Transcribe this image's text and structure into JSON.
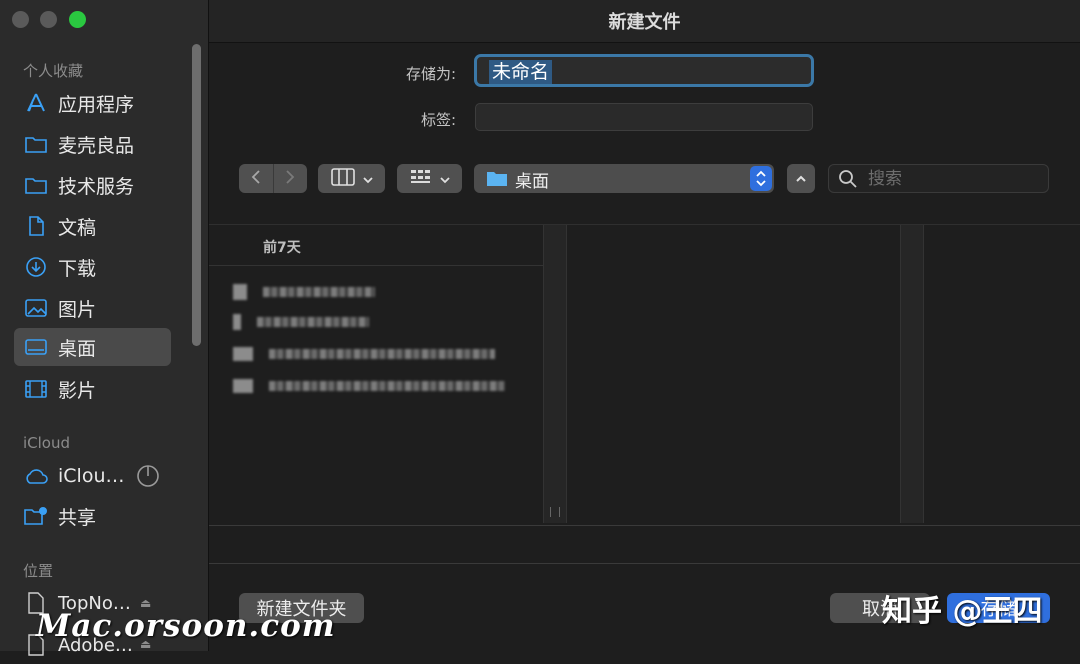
{
  "window": {
    "title": "新建文件"
  },
  "sidebar": {
    "favorites_title": "个人收藏",
    "favorites": [
      {
        "label": "应用程序",
        "icon": "applications-icon"
      },
      {
        "label": "麦壳良品",
        "icon": "folder-icon"
      },
      {
        "label": "技术服务",
        "icon": "folder-icon"
      },
      {
        "label": "文稿",
        "icon": "document-icon"
      },
      {
        "label": "下载",
        "icon": "download-icon"
      },
      {
        "label": "图片",
        "icon": "photos-icon"
      },
      {
        "label": "桌面",
        "icon": "desktop-icon",
        "selected": true
      },
      {
        "label": "影片",
        "icon": "movies-icon"
      }
    ],
    "icloud_title": "iCloud",
    "icloud": [
      {
        "label": "iClou…",
        "icon": "icloud-icon"
      },
      {
        "label": "共享",
        "icon": "shared-folder-icon"
      }
    ],
    "locations_title": "位置",
    "locations": [
      {
        "label": "TopNo…",
        "icon": "disk-icon"
      },
      {
        "label": "Adobe…",
        "icon": "disk-icon"
      }
    ]
  },
  "form": {
    "save_as_label": "存储为:",
    "save_as_value": "未命名",
    "tags_label": "标签:"
  },
  "toolbar": {
    "location": "桌面",
    "search_placeholder": "搜索"
  },
  "browser": {
    "section_header": "前7天"
  },
  "buttons": {
    "new_folder": "新建文件夹",
    "cancel": "取消",
    "save": "存储"
  },
  "overlay": {
    "watermark": "Mac.orsoon.com",
    "zhihu": "知乎 @王四"
  },
  "colors": {
    "accent": "#2f6fde",
    "selection": "#2f5a84"
  }
}
